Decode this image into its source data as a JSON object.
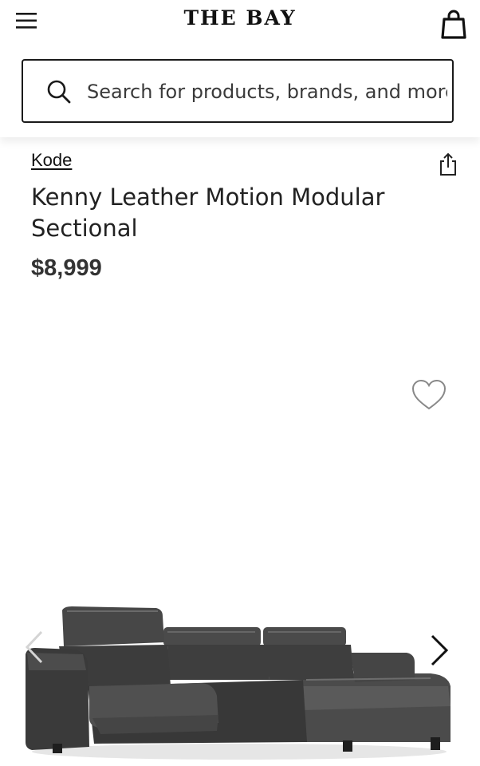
{
  "header": {
    "logo": "THE BAY",
    "menu_icon": "hamburger-icon",
    "bag_icon": "shopping-bag-icon"
  },
  "search": {
    "placeholder": "Search for products, brands, and more",
    "icon": "search-icon"
  },
  "product": {
    "brand": "Kode",
    "title": "Kenny Leather Motion Modular Sectional",
    "price": "$8,999",
    "share_icon": "share-icon",
    "wishlist_icon": "heart-icon"
  },
  "gallery": {
    "image_subject": "dark grey leather sectional sofa",
    "prev_icon": "chevron-left-icon",
    "next_icon": "chevron-right-icon"
  }
}
